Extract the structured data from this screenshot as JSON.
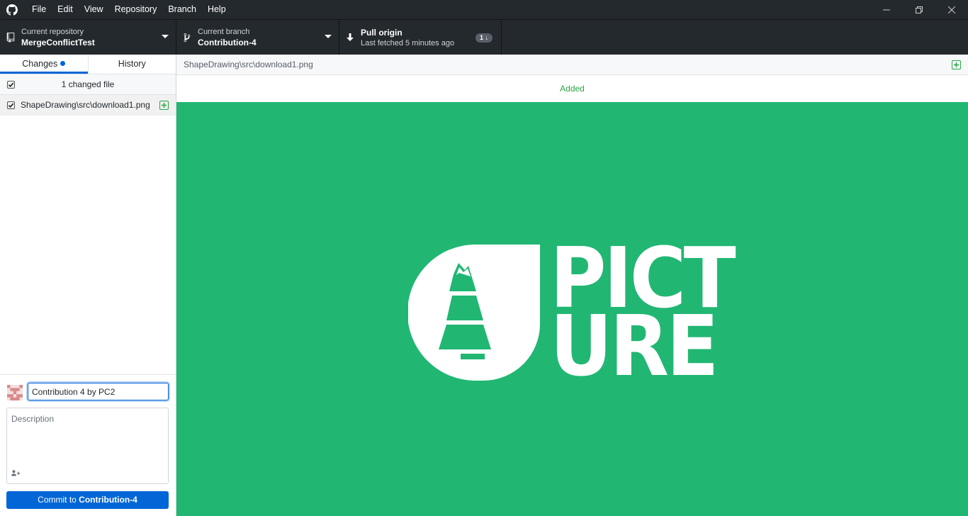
{
  "menu": {
    "items": [
      "File",
      "Edit",
      "View",
      "Repository",
      "Branch",
      "Help"
    ]
  },
  "toolbar": {
    "repository": {
      "label": "Current repository",
      "value": "MergeConflictTest"
    },
    "branch": {
      "label": "Current branch",
      "value": "Contribution-4"
    },
    "pull": {
      "label": "Pull origin",
      "sub": "Last fetched 5 minutes ago",
      "badge": "1"
    }
  },
  "sidebar": {
    "tabs": [
      {
        "label": "Changes",
        "selected": true,
        "has_dot": true
      },
      {
        "label": "History",
        "selected": false
      }
    ],
    "changes_count": "1 changed file",
    "files": [
      {
        "path": "ShapeDrawing\\src\\download1.png",
        "status": "added",
        "checked": true
      }
    ],
    "commit": {
      "summary_value": "Contribution 4 by PC2",
      "description_placeholder": "Description",
      "button_prefix": "Commit to ",
      "button_branch": "Contribution-4"
    }
  },
  "diff": {
    "path": "ShapeDrawing\\src\\download1.png",
    "status": "Added",
    "image": {
      "background_color": "#21b773",
      "logo_line1": "PICT",
      "logo_line2": "URE"
    }
  },
  "colors": {
    "accent": "#0366d6",
    "added": "#28a745",
    "toolbar_bg": "#24292e"
  }
}
